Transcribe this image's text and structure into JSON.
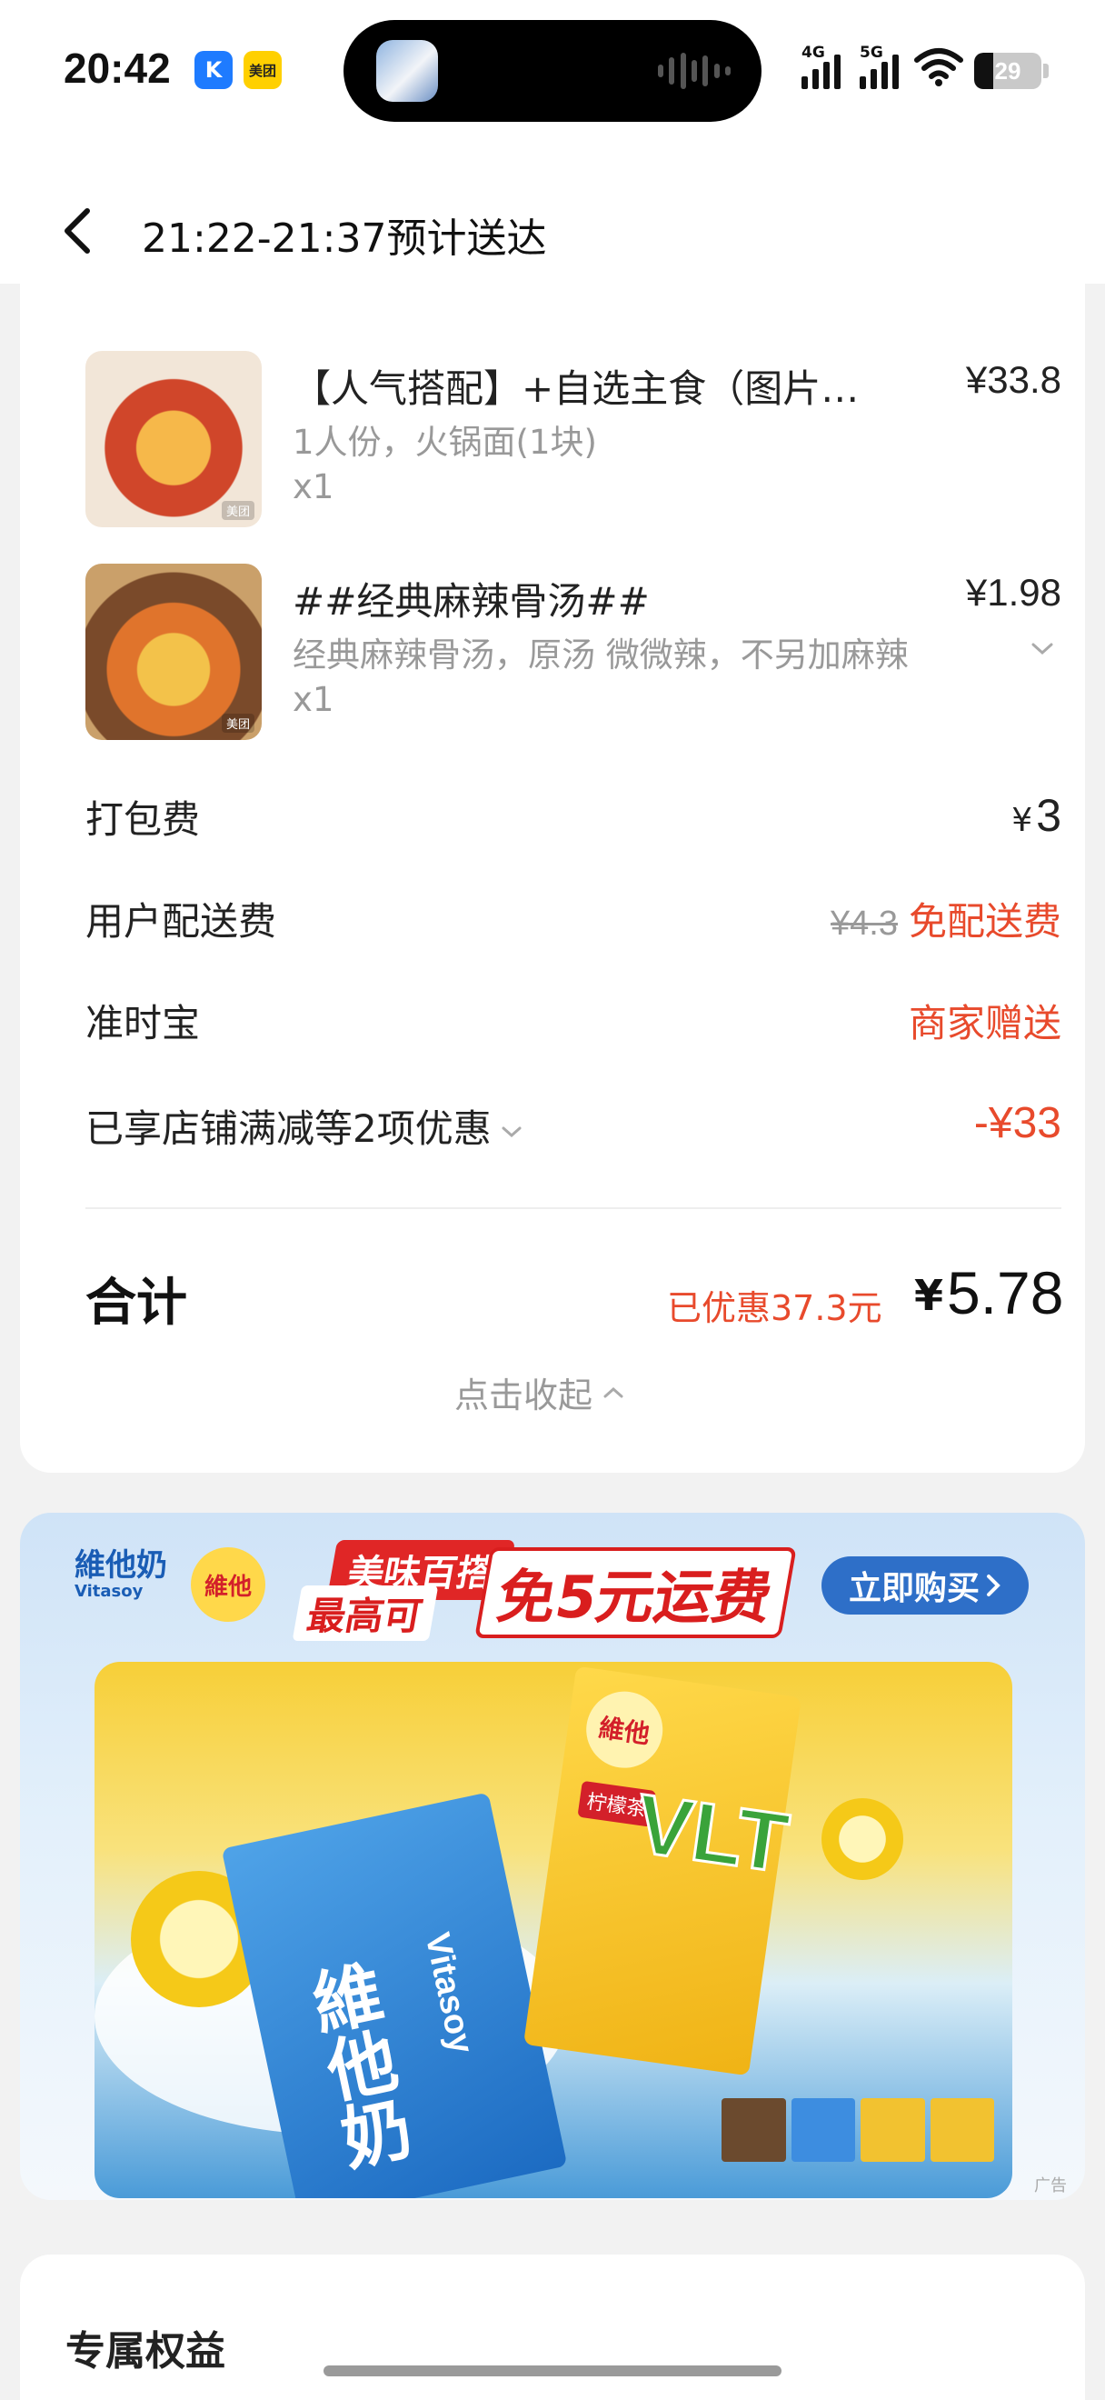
{
  "status_bar": {
    "time": "20:42",
    "app_badges": [
      "K",
      "美团"
    ],
    "network_1": "4G",
    "network_2": "5G",
    "battery_percent": 29,
    "battery_label": "29"
  },
  "header": {
    "title": "21:22-21:37预计送达"
  },
  "items": [
    {
      "name": "【人气搭配】+自选主食（图片仅供参考）",
      "price": "¥33.8",
      "spec": "1人份，火锅面(1块)",
      "qty": "x1",
      "thumb_badge": "美团"
    },
    {
      "name": "##经典麻辣骨汤##",
      "price": "¥1.98",
      "spec": "经典麻辣骨汤，原汤 微微辣，不另加麻辣",
      "qty": "x1",
      "thumb_badge": "美团"
    }
  ],
  "fees": {
    "packing": {
      "label": "打包费",
      "currency": "¥",
      "value": "3"
    },
    "delivery": {
      "label": "用户配送费",
      "original": "¥4.3",
      "value": "免配送费"
    },
    "ontime": {
      "label": "准时宝",
      "value": "商家赠送"
    },
    "discount": {
      "label": "已享店铺满减等2项优惠",
      "value": "-¥33"
    }
  },
  "total": {
    "label": "合计",
    "saved": "已优惠37.3元",
    "currency": "¥",
    "value": "5.78"
  },
  "collapse_label": "点击收起",
  "ad": {
    "brand": "維他奶",
    "brand_sub": "Vitasoy",
    "brand_2": "維他",
    "headline_1": "美味百搭",
    "headline_2": "最高可",
    "headline_3": "免5元运费",
    "buy_button": "立即购买",
    "blue_carton_text": "維他奶",
    "blue_carton_sub": "Vitasoy",
    "yellow_tag": "柠檬茶",
    "yellow_big": "VLT",
    "tag": "广告"
  },
  "benefit": {
    "title": "专属权益"
  },
  "colors": {
    "accent_red": "#e84a2c",
    "text_gray": "#999999",
    "ad_blue": "#2e6fc8"
  }
}
